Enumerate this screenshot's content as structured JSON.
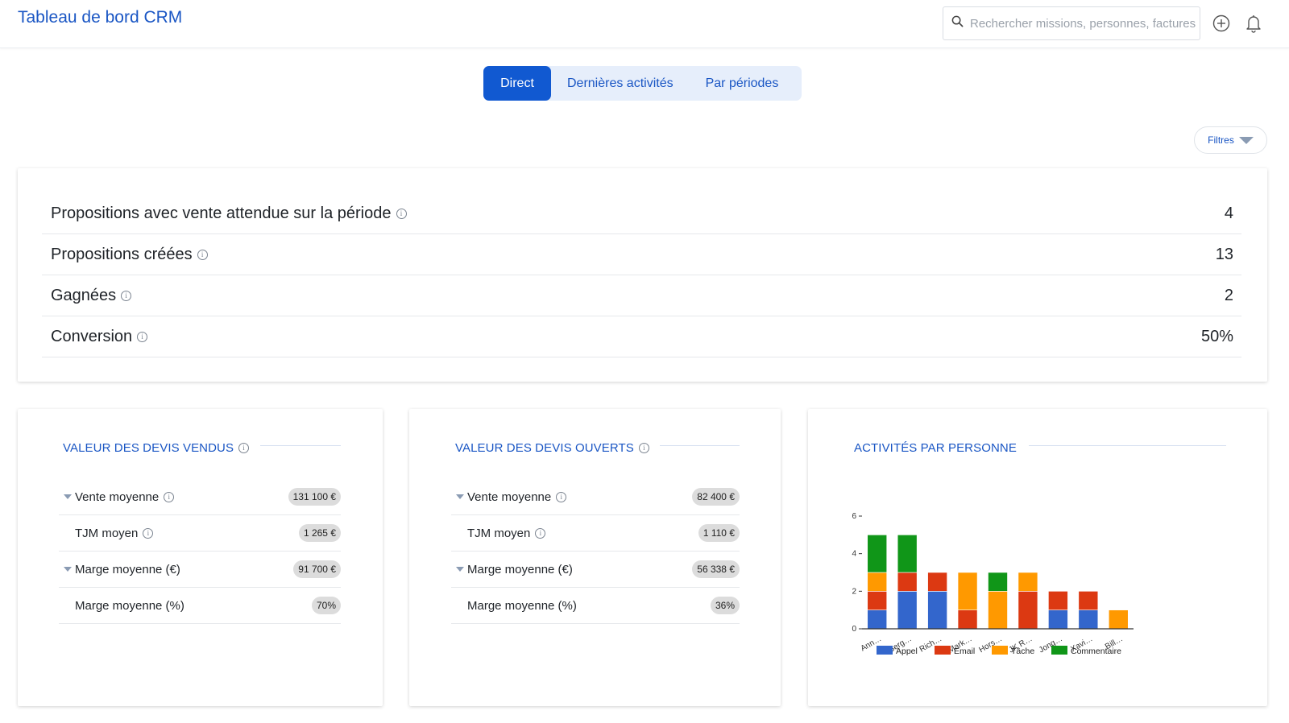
{
  "header": {
    "title": "Tableau de bord CRM",
    "search_placeholder": "Rechercher missions, personnes, factures"
  },
  "tabs": [
    {
      "label": "Direct",
      "active": true
    },
    {
      "label": "Dernières activités",
      "active": false
    },
    {
      "label": "Par périodes",
      "active": false
    }
  ],
  "filters_label": "Filtres",
  "kpis": [
    {
      "label": "Propositions avec vente attendue sur la période",
      "value": "4"
    },
    {
      "label": "Propositions créées",
      "value": "13"
    },
    {
      "label": "Gagnées",
      "value": "2"
    },
    {
      "label": "Conversion",
      "value": "50%"
    }
  ],
  "sold": {
    "title": "VALEUR DES DEVIS VENDUS",
    "rows": [
      {
        "label": "Vente moyenne",
        "value": "131 100 €"
      },
      {
        "label": "TJM moyen",
        "value": "1 265 €"
      },
      {
        "label": "Marge moyenne (€)",
        "value": "91 700 €"
      },
      {
        "label": "Marge moyenne (%)",
        "value": "70%"
      }
    ]
  },
  "open": {
    "title": "VALEUR DES DEVIS OUVERTS",
    "rows": [
      {
        "label": "Vente moyenne",
        "value": "82 400 €"
      },
      {
        "label": "TJM moyen",
        "value": "1 110 €"
      },
      {
        "label": "Marge moyenne (€)",
        "value": "56 338 €"
      },
      {
        "label": "Marge moyenne (%)",
        "value": "36%"
      }
    ]
  },
  "activities_title": "ACTIVITÉS PAR PERSONNE",
  "colors": {
    "accent": "#1159d1",
    "appel": "#3366cc",
    "email": "#dc3912",
    "tache": "#ff9900",
    "commentaire": "#109618"
  },
  "chart_data": {
    "type": "bar",
    "stacked": true,
    "categories": [
      "Ann…",
      "Serg…",
      "Rich…",
      "Mark…",
      "Hors…",
      "JK R…",
      "Jong…",
      "Xavi…",
      "Bill…"
    ],
    "series": [
      {
        "name": "Appel",
        "color": "#3366cc",
        "values": [
          1,
          2,
          2,
          0,
          0,
          0,
          1,
          1,
          0
        ]
      },
      {
        "name": "Email",
        "color": "#dc3912",
        "values": [
          1,
          1,
          1,
          1,
          0,
          2,
          1,
          1,
          0
        ]
      },
      {
        "name": "Tâche",
        "color": "#ff9900",
        "values": [
          1,
          0,
          0,
          2,
          2,
          1,
          0,
          0,
          1
        ]
      },
      {
        "name": "Commentaire",
        "color": "#109618",
        "values": [
          2,
          2,
          0,
          0,
          1,
          0,
          0,
          0,
          0
        ]
      }
    ],
    "ylim": [
      0,
      6
    ],
    "yticks": [
      "0",
      "2",
      "4",
      "6"
    ],
    "legend": "bottom",
    "grid": false
  }
}
